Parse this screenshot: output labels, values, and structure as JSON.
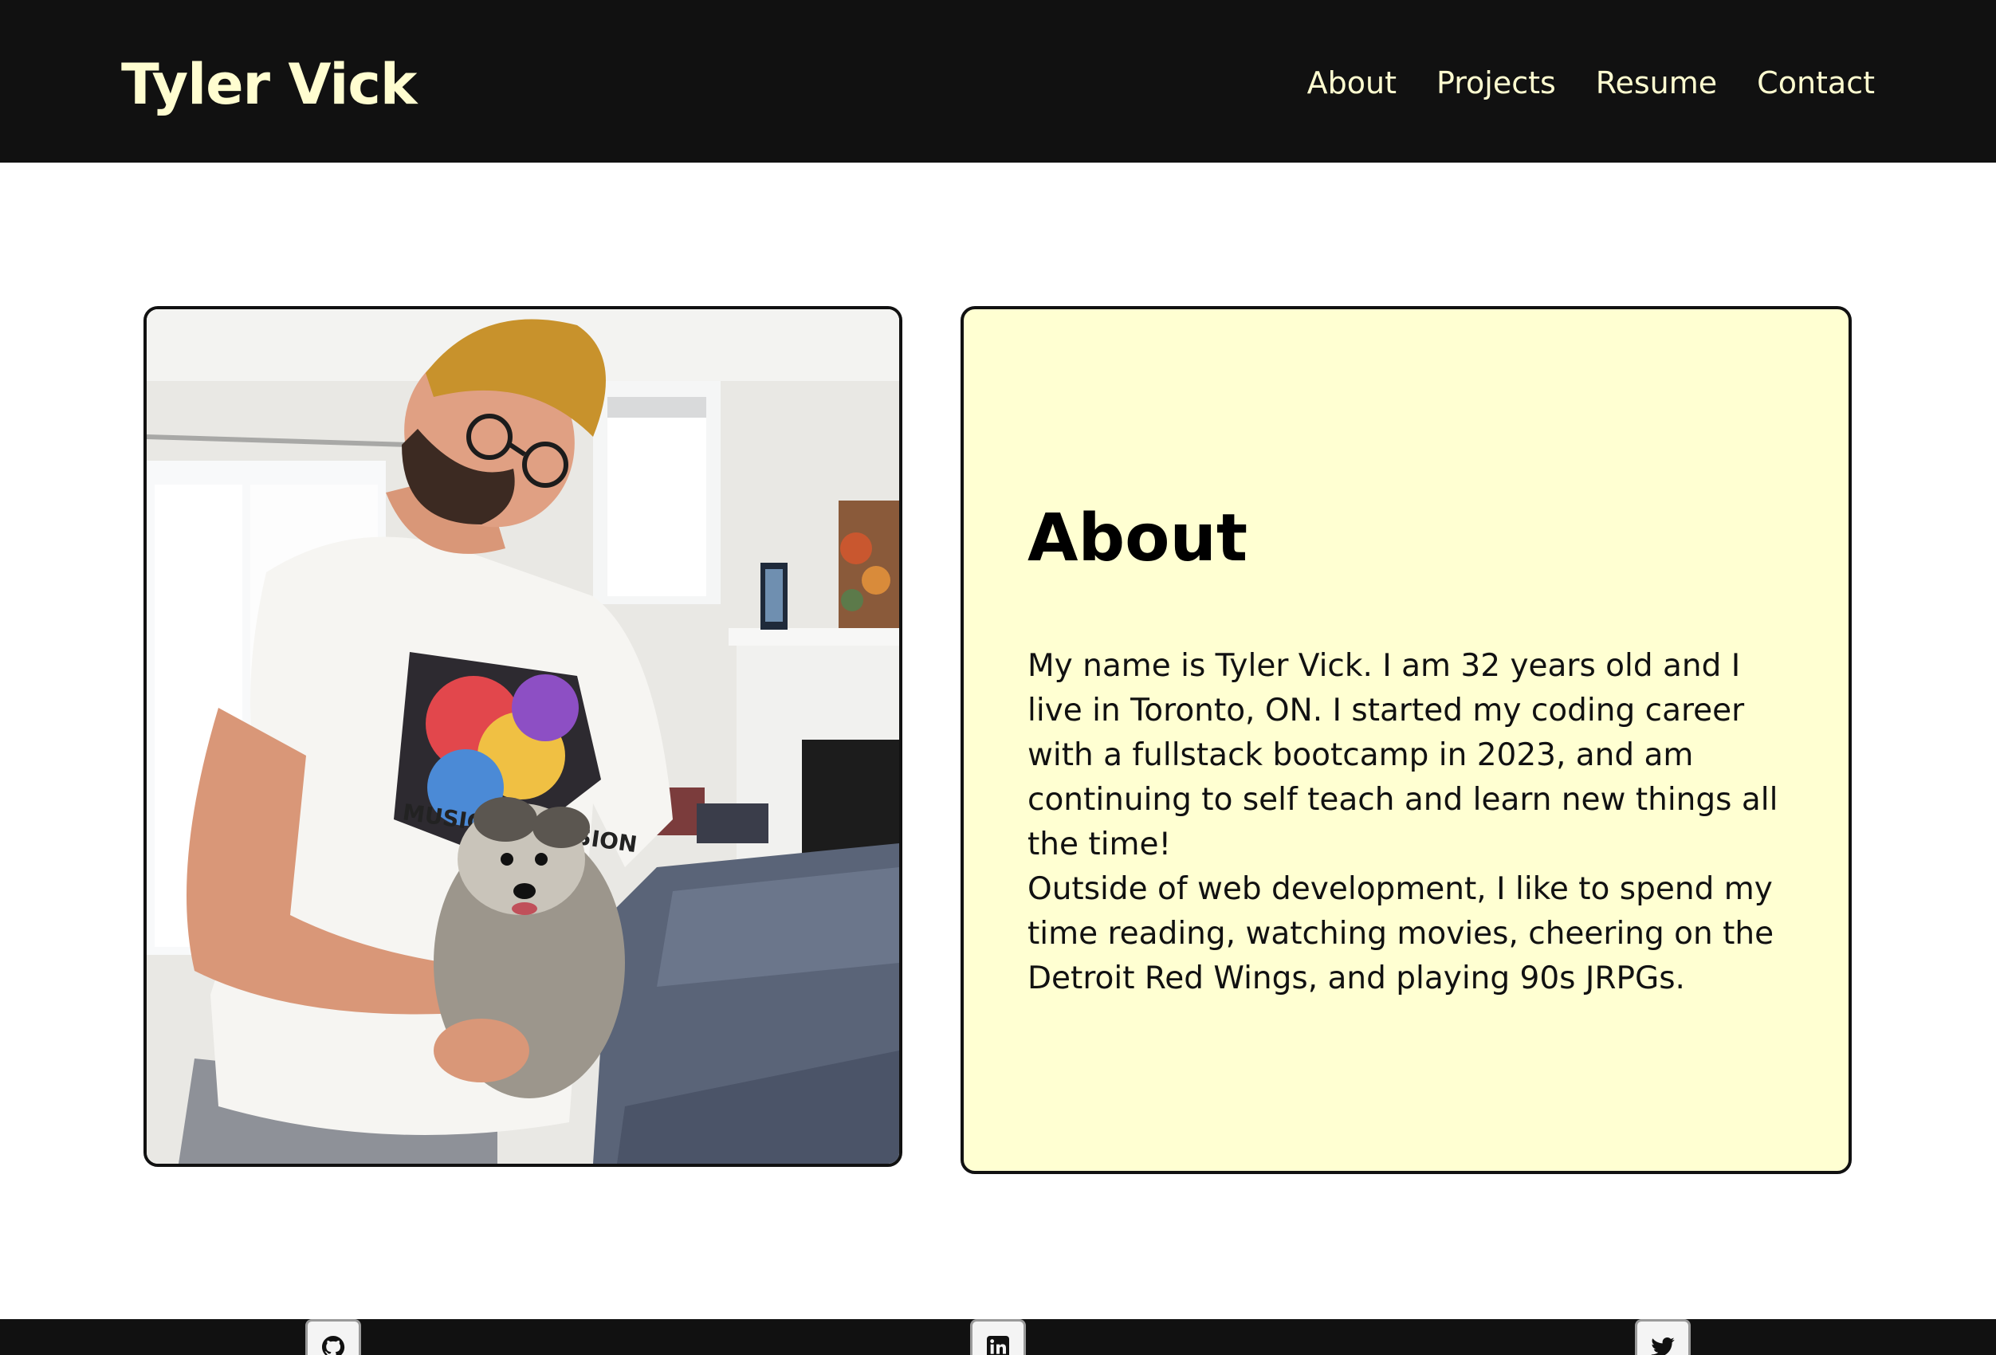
{
  "header": {
    "site_title": "Tyler Vick",
    "nav": [
      {
        "label": "About"
      },
      {
        "label": "Projects"
      },
      {
        "label": "Resume"
      },
      {
        "label": "Contact"
      }
    ]
  },
  "photo": {
    "icon": "profile-photo"
  },
  "about": {
    "heading": "About",
    "paragraphs": [
      "My name is Tyler Vick. I am 32 years old and I live in Toronto, ON. I started my coding career with a fullstack bootcamp in 2023, and am continuing to self teach and learn new things all the time!",
      "Outside of web development, I like to spend my time reading, watching movies, cheering on the Detroit Red Wings, and playing 90s JRPGs."
    ]
  },
  "footer": {
    "social": [
      {
        "icon": "github-icon"
      },
      {
        "icon": "linkedin-icon"
      },
      {
        "icon": "twitter-icon"
      }
    ]
  },
  "colors": {
    "header_bg": "#111111",
    "header_text": "#fffdd0",
    "card_bg": "#ffffd2",
    "card_border": "#111111",
    "footer_bg": "#111111"
  }
}
